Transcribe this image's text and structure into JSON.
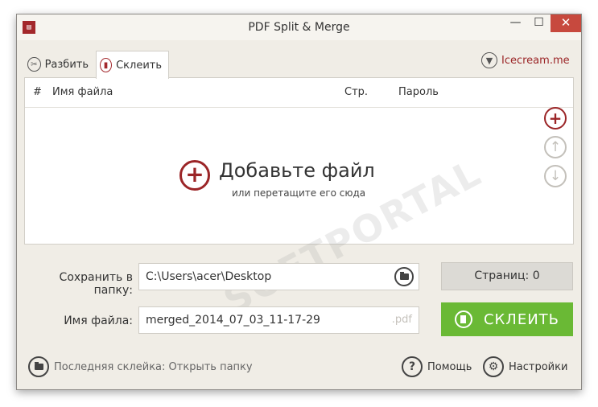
{
  "window": {
    "title": "PDF Split & Merge",
    "app_icon_glyph": "▤",
    "controls": {
      "minimize": "—",
      "maximize": "☐",
      "close": "✕"
    }
  },
  "tabs": [
    {
      "label": "Разбить",
      "icon": "scissors-icon",
      "active": false
    },
    {
      "label": "Склеить",
      "icon": "merge-icon",
      "active": true
    }
  ],
  "brand": {
    "label": "Icecream.me",
    "icon": "icecream-icon"
  },
  "file_list": {
    "columns": {
      "num": "#",
      "name": "Имя файла",
      "pages": "Стр.",
      "password": "Пароль"
    },
    "empty": {
      "title": "Добавьте файл",
      "subtitle": "или перетащите его сюда"
    },
    "watermark": "SOFTPORTAL"
  },
  "side_buttons": {
    "add": "+",
    "up": "↑",
    "down": "↓"
  },
  "save_folder": {
    "label": "Сохранить в папку:",
    "value": "C:\\Users\\acer\\Desktop"
  },
  "file_name": {
    "label": "Имя файла:",
    "value": "merged_2014_07_03_11-17-29",
    "extension": ".pdf"
  },
  "pages_button": {
    "label": "Страниц: 0"
  },
  "merge_button": {
    "label": "СКЛЕИТЬ"
  },
  "footer": {
    "last_merge": "Последняя склейка: Открыть папку",
    "help": "Помощь",
    "help_glyph": "?",
    "settings": "Настройки",
    "settings_glyph": "⚙"
  },
  "colors": {
    "accent": "#9b2527",
    "merge_green": "#6ab935",
    "window_bg": "#f0ede6"
  }
}
